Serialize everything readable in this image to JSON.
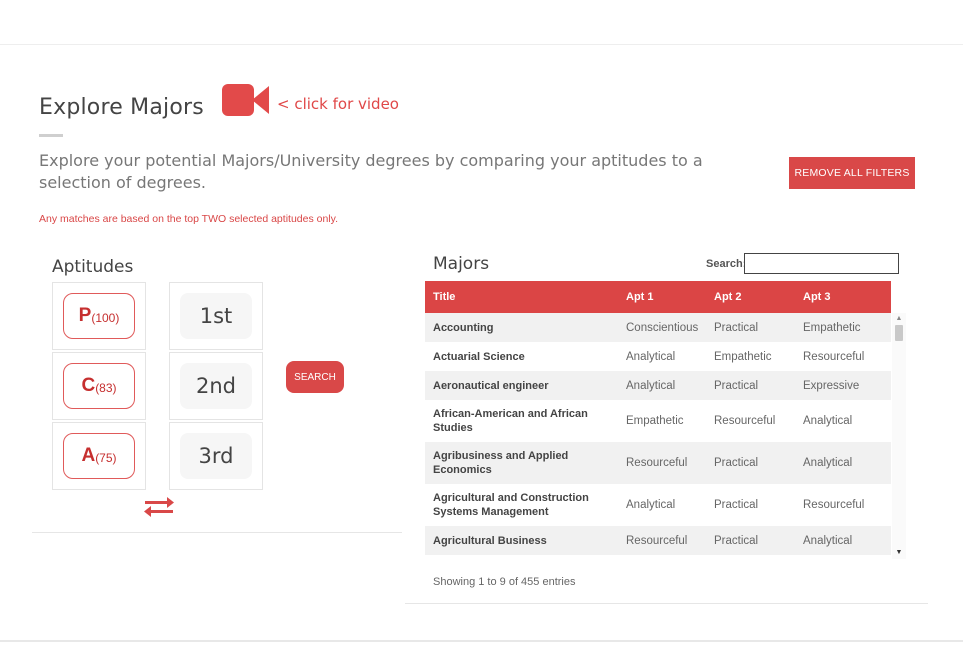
{
  "header": {
    "title": "Explore Majors",
    "video_link": "< click for video",
    "video_icon": "video-camera-icon",
    "description": "Explore your potential Majors/University degrees by comparing your aptitudes to a selection of degrees.",
    "note": "Any matches are based on the top TWO selected aptitudes only.",
    "remove_filters_label": "REMOVE ALL FILTERS"
  },
  "aptitudes": {
    "title": "Aptitudes",
    "items": [
      {
        "letter": "P",
        "score": "(100)"
      },
      {
        "letter": "C",
        "score": "(83)"
      },
      {
        "letter": "A",
        "score": "(75)"
      }
    ],
    "slots": [
      "1st",
      "2nd",
      "3rd"
    ],
    "search_label": "SEARCH",
    "swap_icon": "swap-arrows-icon"
  },
  "majors": {
    "title": "Majors",
    "search_label": "Search:",
    "search_value": "",
    "columns": [
      "Title",
      "Apt 1",
      "Apt 2",
      "Apt 3"
    ],
    "rows": [
      {
        "title": "Accounting",
        "apt1": "Conscientious",
        "apt2": "Practical",
        "apt3": "Empathetic"
      },
      {
        "title": "Actuarial Science",
        "apt1": "Analytical",
        "apt2": "Empathetic",
        "apt3": "Resourceful"
      },
      {
        "title": "Aeronautical engineer",
        "apt1": "Analytical",
        "apt2": "Practical",
        "apt3": "Expressive"
      },
      {
        "title": "African-American and African Studies",
        "apt1": "Empathetic",
        "apt2": "Resourceful",
        "apt3": "Analytical"
      },
      {
        "title": "Agribusiness and Applied Economics",
        "apt1": "Resourceful",
        "apt2": "Practical",
        "apt3": "Analytical"
      },
      {
        "title": "Agricultural and Construction Systems Management",
        "apt1": "Analytical",
        "apt2": "Practical",
        "apt3": "Resourceful"
      },
      {
        "title": "Agricultural Business",
        "apt1": "Resourceful",
        "apt2": "Practical",
        "apt3": "Analytical"
      }
    ],
    "info": "Showing 1 to 9 of 455 entries"
  },
  "colors": {
    "accent": "#d94848",
    "header_row": "#db4545",
    "stripe": "#f1f1f1"
  }
}
